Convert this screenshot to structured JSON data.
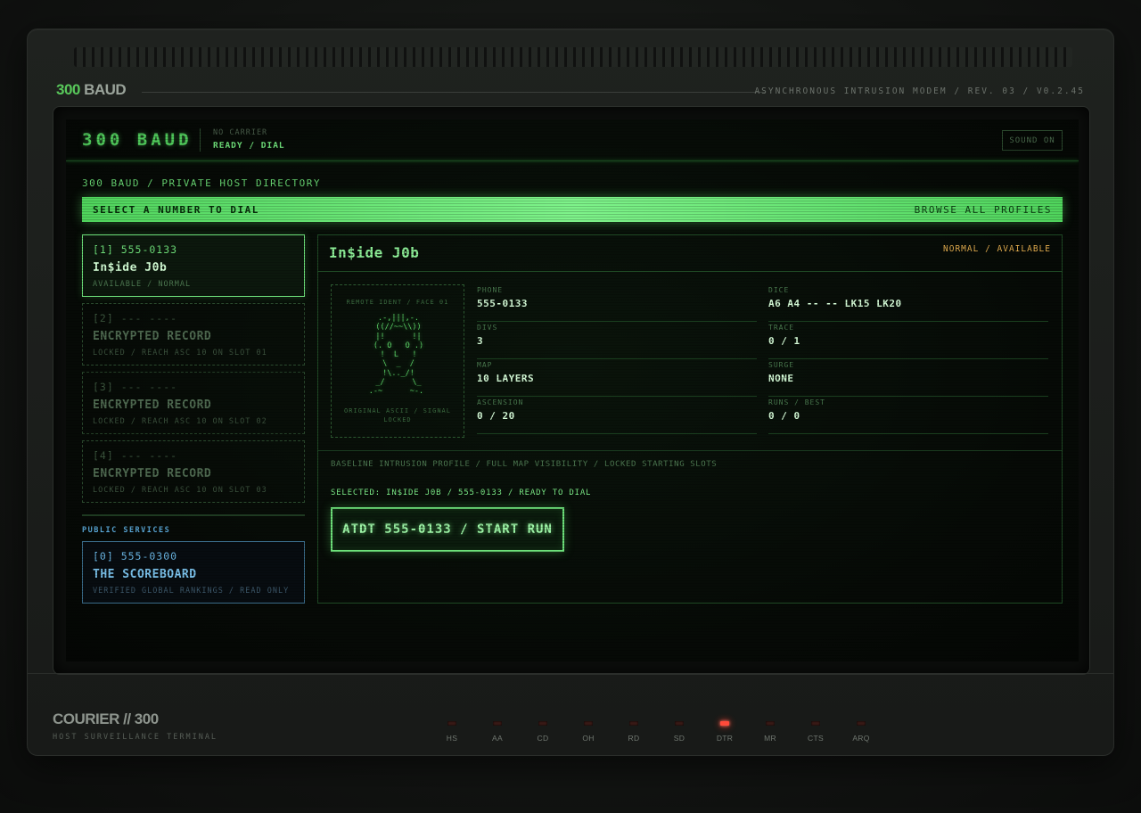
{
  "chassis": {
    "brand_num": "300",
    "brand_word": " BAUD",
    "revision": "ASYNCHRONOUS INTRUSION MODEM / REV. 03 / V0.2.45",
    "footer_title": "COURIER // 300",
    "footer_sub": "HOST SURVEILLANCE TERMINAL",
    "leds": [
      {
        "label": "HS",
        "on": false
      },
      {
        "label": "AA",
        "on": false
      },
      {
        "label": "CD",
        "on": false
      },
      {
        "label": "OH",
        "on": false
      },
      {
        "label": "RD",
        "on": false
      },
      {
        "label": "SD",
        "on": false
      },
      {
        "label": "DTR",
        "on": true
      },
      {
        "label": "MR",
        "on": false
      },
      {
        "label": "CTS",
        "on": false
      },
      {
        "label": "ARQ",
        "on": false
      }
    ]
  },
  "screen": {
    "title": "300 BAUD",
    "carrier": "NO CARRIER",
    "state": "READY / DIAL",
    "sound_button": "SOUND ON",
    "directory_path": "300 BAUD / PRIVATE HOST DIRECTORY",
    "select_prompt": "SELECT A NUMBER TO DIAL",
    "browse_all": "BROWSE ALL PROFILES"
  },
  "hosts": [
    {
      "number": "[1] 555-0133",
      "name": "In$ide J0b",
      "sub": "AVAILABLE / NORMAL"
    },
    {
      "number": "[2] --- ----",
      "name": "ENCRYPTED RECORD",
      "sub": "LOCKED / REACH ASC 10 ON SLOT 01"
    },
    {
      "number": "[3] --- ----",
      "name": "ENCRYPTED RECORD",
      "sub": "LOCKED / REACH ASC 10 ON SLOT 02"
    },
    {
      "number": "[4] --- ----",
      "name": "ENCRYPTED RECORD",
      "sub": "LOCKED / REACH ASC 10 ON SLOT 03"
    }
  ],
  "public_services": {
    "label": "PUBLIC SERVICES",
    "number": "[0] 555-0300",
    "name": "THE SCOREBOARD",
    "sub": "VERIFIED GLOBAL RANKINGS / READ ONLY"
  },
  "detail": {
    "name": "In$ide J0b",
    "status_mode": "NORMAL",
    "status_sep": " / ",
    "status_avail": "AVAILABLE",
    "ident_label": "REMOTE IDENT / FACE 01",
    "ident_footer": "ORIGINAL ASCII / SIGNAL LOCKED",
    "ascii_face": "  .-,|||,-.  \n ((//~~\\\\)) \n |!      !| \n (. O   O .) \n  !  L   !  \n   \\  _  /   \n   !\\.._/!   \n  _/      \\_  \n.-~      ~-. ",
    "fields_left": [
      {
        "key": "PHONE",
        "value": "555-0133"
      },
      {
        "key": "DIVS",
        "value": "3"
      },
      {
        "key": "MAP",
        "value": "10 LAYERS"
      },
      {
        "key": "ASCENSION",
        "value": "0 / 20"
      }
    ],
    "fields_right": [
      {
        "key": "DICE",
        "value": "A6 A4 -- -- LK15 LK20"
      },
      {
        "key": "TRACE",
        "value": "0 / 1"
      },
      {
        "key": "SURGE",
        "value": "NONE"
      },
      {
        "key": "RUNS / BEST",
        "value": "0 / 0"
      }
    ],
    "baseline": "BASELINE INTRUSION PROFILE / FULL MAP VISIBILITY / LOCKED STARTING SLOTS",
    "selected": "SELECTED: IN$IDE J0B / 555-0133 / READY TO DIAL",
    "run_button": "ATDT 555-0133 / START RUN"
  },
  "colors": {
    "phosphor_green": "#6fe07a",
    "status_amber": "#e8b050",
    "public_blue": "#6bb8e6",
    "led_red": "#ff4a3a"
  }
}
